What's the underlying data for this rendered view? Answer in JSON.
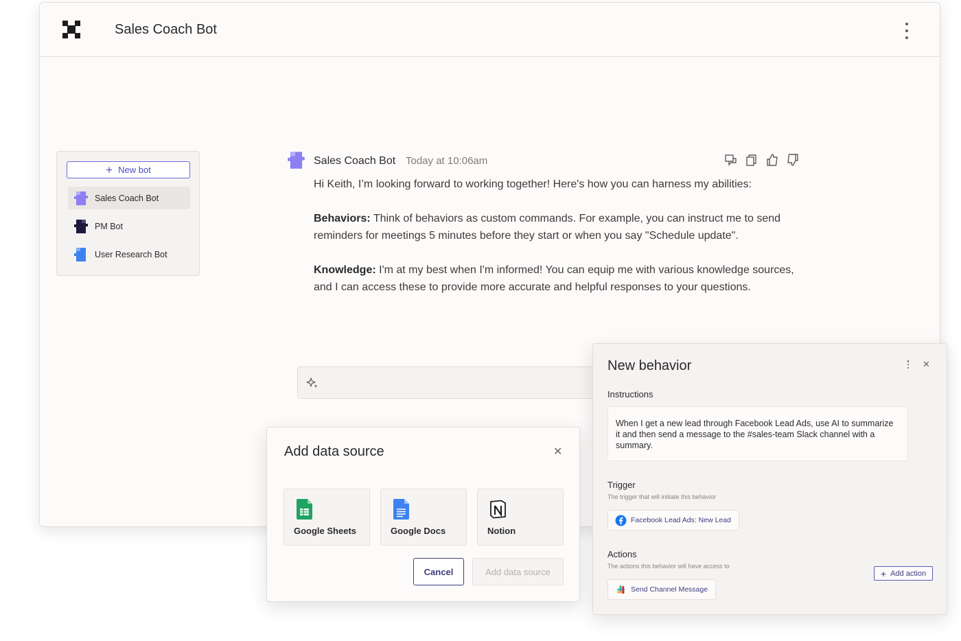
{
  "app": {
    "title": "Sales Coach Bot"
  },
  "sidebar": {
    "new_bot_label": "New bot",
    "items": [
      {
        "label": "Sales Coach Bot",
        "color": "#8e7ff3",
        "active": true
      },
      {
        "label": "PM Bot",
        "color": "#1e1a3d",
        "active": false
      },
      {
        "label": "User Research Bot",
        "color": "#3d82f0",
        "active": false
      }
    ]
  },
  "message": {
    "sender": "Sales Coach Bot",
    "time": "Today at 10:06am",
    "greeting": "Hi Keith, I’m looking forward to working together! Here's how you can harness my abilities:",
    "behaviors_label": "Behaviors:",
    "behaviors_text": " Think of behaviors as custom commands.  For example, you can instruct me to send reminders for meetings 5 minutes before they start or when you say \"Schedule update\".",
    "knowledge_label": "Knowledge:",
    "knowledge_text": " I'm at my best when I'm informed! You can equip me with various knowledge sources, and I can access these to provide more accurate and helpful responses to your questions."
  },
  "add_source_dialog": {
    "title": "Add data source",
    "sources": [
      {
        "label": "Google Sheets",
        "icon": "google-sheets-icon"
      },
      {
        "label": "Google Docs",
        "icon": "google-docs-icon"
      },
      {
        "label": "Notion",
        "icon": "notion-icon"
      }
    ],
    "cancel_label": "Cancel",
    "add_label": "Add data source"
  },
  "behavior_panel": {
    "title": "New behavior",
    "instructions_label": "Instructions",
    "instructions_text": "When I get a new lead through Facebook Lead Ads, use AI to summarize it and then send a message to the #sales-team Slack channel with a summary.",
    "trigger_label": "Trigger",
    "trigger_desc": "The trigger that will initiate this behavior",
    "trigger_value": "Facebook Lead Ads: New Lead",
    "actions_label": "Actions",
    "actions_desc": "The actions this behavior will have access to",
    "add_action_label": "Add action",
    "action_value": "Send Channel Message"
  },
  "colors": {
    "accent": "#4b4bc3",
    "brand_purple": "#8e7ff3"
  }
}
